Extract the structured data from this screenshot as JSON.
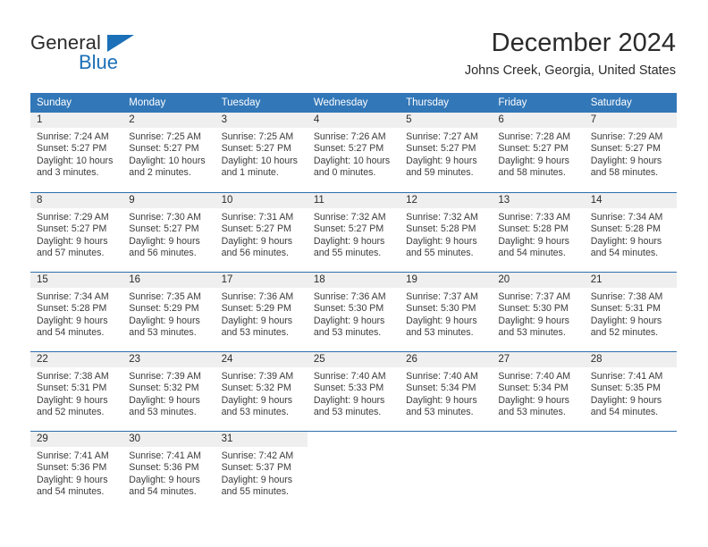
{
  "logo": {
    "word1": "General",
    "word2": "Blue",
    "triangle_color": "#1b70b8"
  },
  "header": {
    "title": "December 2024",
    "subtitle": "Johns Creek, Georgia, United States"
  },
  "theme": {
    "header_bg": "#3277b8",
    "daynum_bg": "#efefef",
    "row_separator": "#2e6fad",
    "text": "#2b2b2b"
  },
  "labels": {
    "sunrise_prefix": "Sunrise:",
    "sunset_prefix": "Sunset:",
    "daylight_prefix": "Daylight:"
  },
  "weekdays": [
    "Sunday",
    "Monday",
    "Tuesday",
    "Wednesday",
    "Thursday",
    "Friday",
    "Saturday"
  ],
  "weeks": [
    [
      {
        "day": "1",
        "sunrise": "Sunrise: 7:24 AM",
        "sunset": "Sunset: 5:27 PM",
        "daylight_line1": "Daylight: 10 hours",
        "daylight_line2": "and 3 minutes."
      },
      {
        "day": "2",
        "sunrise": "Sunrise: 7:25 AM",
        "sunset": "Sunset: 5:27 PM",
        "daylight_line1": "Daylight: 10 hours",
        "daylight_line2": "and 2 minutes."
      },
      {
        "day": "3",
        "sunrise": "Sunrise: 7:25 AM",
        "sunset": "Sunset: 5:27 PM",
        "daylight_line1": "Daylight: 10 hours",
        "daylight_line2": "and 1 minute."
      },
      {
        "day": "4",
        "sunrise": "Sunrise: 7:26 AM",
        "sunset": "Sunset: 5:27 PM",
        "daylight_line1": "Daylight: 10 hours",
        "daylight_line2": "and 0 minutes."
      },
      {
        "day": "5",
        "sunrise": "Sunrise: 7:27 AM",
        "sunset": "Sunset: 5:27 PM",
        "daylight_line1": "Daylight: 9 hours",
        "daylight_line2": "and 59 minutes."
      },
      {
        "day": "6",
        "sunrise": "Sunrise: 7:28 AM",
        "sunset": "Sunset: 5:27 PM",
        "daylight_line1": "Daylight: 9 hours",
        "daylight_line2": "and 58 minutes."
      },
      {
        "day": "7",
        "sunrise": "Sunrise: 7:29 AM",
        "sunset": "Sunset: 5:27 PM",
        "daylight_line1": "Daylight: 9 hours",
        "daylight_line2": "and 58 minutes."
      }
    ],
    [
      {
        "day": "8",
        "sunrise": "Sunrise: 7:29 AM",
        "sunset": "Sunset: 5:27 PM",
        "daylight_line1": "Daylight: 9 hours",
        "daylight_line2": "and 57 minutes."
      },
      {
        "day": "9",
        "sunrise": "Sunrise: 7:30 AM",
        "sunset": "Sunset: 5:27 PM",
        "daylight_line1": "Daylight: 9 hours",
        "daylight_line2": "and 56 minutes."
      },
      {
        "day": "10",
        "sunrise": "Sunrise: 7:31 AM",
        "sunset": "Sunset: 5:27 PM",
        "daylight_line1": "Daylight: 9 hours",
        "daylight_line2": "and 56 minutes."
      },
      {
        "day": "11",
        "sunrise": "Sunrise: 7:32 AM",
        "sunset": "Sunset: 5:27 PM",
        "daylight_line1": "Daylight: 9 hours",
        "daylight_line2": "and 55 minutes."
      },
      {
        "day": "12",
        "sunrise": "Sunrise: 7:32 AM",
        "sunset": "Sunset: 5:28 PM",
        "daylight_line1": "Daylight: 9 hours",
        "daylight_line2": "and 55 minutes."
      },
      {
        "day": "13",
        "sunrise": "Sunrise: 7:33 AM",
        "sunset": "Sunset: 5:28 PM",
        "daylight_line1": "Daylight: 9 hours",
        "daylight_line2": "and 54 minutes."
      },
      {
        "day": "14",
        "sunrise": "Sunrise: 7:34 AM",
        "sunset": "Sunset: 5:28 PM",
        "daylight_line1": "Daylight: 9 hours",
        "daylight_line2": "and 54 minutes."
      }
    ],
    [
      {
        "day": "15",
        "sunrise": "Sunrise: 7:34 AM",
        "sunset": "Sunset: 5:28 PM",
        "daylight_line1": "Daylight: 9 hours",
        "daylight_line2": "and 54 minutes."
      },
      {
        "day": "16",
        "sunrise": "Sunrise: 7:35 AM",
        "sunset": "Sunset: 5:29 PM",
        "daylight_line1": "Daylight: 9 hours",
        "daylight_line2": "and 53 minutes."
      },
      {
        "day": "17",
        "sunrise": "Sunrise: 7:36 AM",
        "sunset": "Sunset: 5:29 PM",
        "daylight_line1": "Daylight: 9 hours",
        "daylight_line2": "and 53 minutes."
      },
      {
        "day": "18",
        "sunrise": "Sunrise: 7:36 AM",
        "sunset": "Sunset: 5:30 PM",
        "daylight_line1": "Daylight: 9 hours",
        "daylight_line2": "and 53 minutes."
      },
      {
        "day": "19",
        "sunrise": "Sunrise: 7:37 AM",
        "sunset": "Sunset: 5:30 PM",
        "daylight_line1": "Daylight: 9 hours",
        "daylight_line2": "and 53 minutes."
      },
      {
        "day": "20",
        "sunrise": "Sunrise: 7:37 AM",
        "sunset": "Sunset: 5:30 PM",
        "daylight_line1": "Daylight: 9 hours",
        "daylight_line2": "and 53 minutes."
      },
      {
        "day": "21",
        "sunrise": "Sunrise: 7:38 AM",
        "sunset": "Sunset: 5:31 PM",
        "daylight_line1": "Daylight: 9 hours",
        "daylight_line2": "and 52 minutes."
      }
    ],
    [
      {
        "day": "22",
        "sunrise": "Sunrise: 7:38 AM",
        "sunset": "Sunset: 5:31 PM",
        "daylight_line1": "Daylight: 9 hours",
        "daylight_line2": "and 52 minutes."
      },
      {
        "day": "23",
        "sunrise": "Sunrise: 7:39 AM",
        "sunset": "Sunset: 5:32 PM",
        "daylight_line1": "Daylight: 9 hours",
        "daylight_line2": "and 53 minutes."
      },
      {
        "day": "24",
        "sunrise": "Sunrise: 7:39 AM",
        "sunset": "Sunset: 5:32 PM",
        "daylight_line1": "Daylight: 9 hours",
        "daylight_line2": "and 53 minutes."
      },
      {
        "day": "25",
        "sunrise": "Sunrise: 7:40 AM",
        "sunset": "Sunset: 5:33 PM",
        "daylight_line1": "Daylight: 9 hours",
        "daylight_line2": "and 53 minutes."
      },
      {
        "day": "26",
        "sunrise": "Sunrise: 7:40 AM",
        "sunset": "Sunset: 5:34 PM",
        "daylight_line1": "Daylight: 9 hours",
        "daylight_line2": "and 53 minutes."
      },
      {
        "day": "27",
        "sunrise": "Sunrise: 7:40 AM",
        "sunset": "Sunset: 5:34 PM",
        "daylight_line1": "Daylight: 9 hours",
        "daylight_line2": "and 53 minutes."
      },
      {
        "day": "28",
        "sunrise": "Sunrise: 7:41 AM",
        "sunset": "Sunset: 5:35 PM",
        "daylight_line1": "Daylight: 9 hours",
        "daylight_line2": "and 54 minutes."
      }
    ],
    [
      {
        "day": "29",
        "sunrise": "Sunrise: 7:41 AM",
        "sunset": "Sunset: 5:36 PM",
        "daylight_line1": "Daylight: 9 hours",
        "daylight_line2": "and 54 minutes."
      },
      {
        "day": "30",
        "sunrise": "Sunrise: 7:41 AM",
        "sunset": "Sunset: 5:36 PM",
        "daylight_line1": "Daylight: 9 hours",
        "daylight_line2": "and 54 minutes."
      },
      {
        "day": "31",
        "sunrise": "Sunrise: 7:42 AM",
        "sunset": "Sunset: 5:37 PM",
        "daylight_line1": "Daylight: 9 hours",
        "daylight_line2": "and 55 minutes."
      },
      {
        "day": "",
        "sunrise": "",
        "sunset": "",
        "daylight_line1": "",
        "daylight_line2": ""
      },
      {
        "day": "",
        "sunrise": "",
        "sunset": "",
        "daylight_line1": "",
        "daylight_line2": ""
      },
      {
        "day": "",
        "sunrise": "",
        "sunset": "",
        "daylight_line1": "",
        "daylight_line2": ""
      },
      {
        "day": "",
        "sunrise": "",
        "sunset": "",
        "daylight_line1": "",
        "daylight_line2": ""
      }
    ]
  ]
}
